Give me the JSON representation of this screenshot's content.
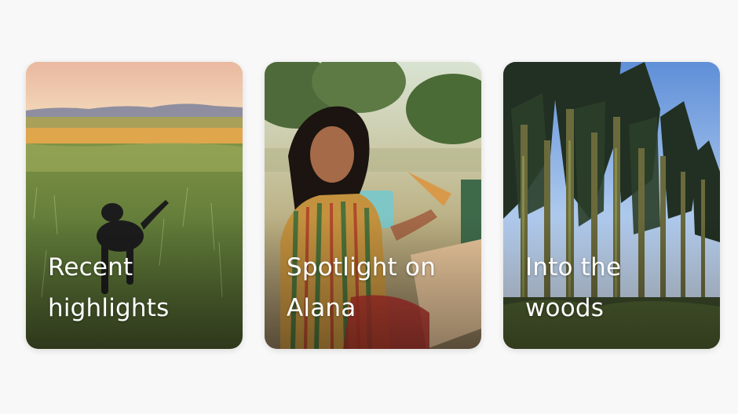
{
  "cards": [
    {
      "title": "Recent\nhighlights",
      "image": "dog-in-meadow-photo"
    },
    {
      "title": "Spotlight on\nAlana",
      "image": "woman-eating-pizza-photo"
    },
    {
      "title": "Into the\nwoods",
      "image": "pine-forest-photo"
    }
  ],
  "colors": {
    "background": "#f8f8f8",
    "title_text": "#ffffff"
  }
}
